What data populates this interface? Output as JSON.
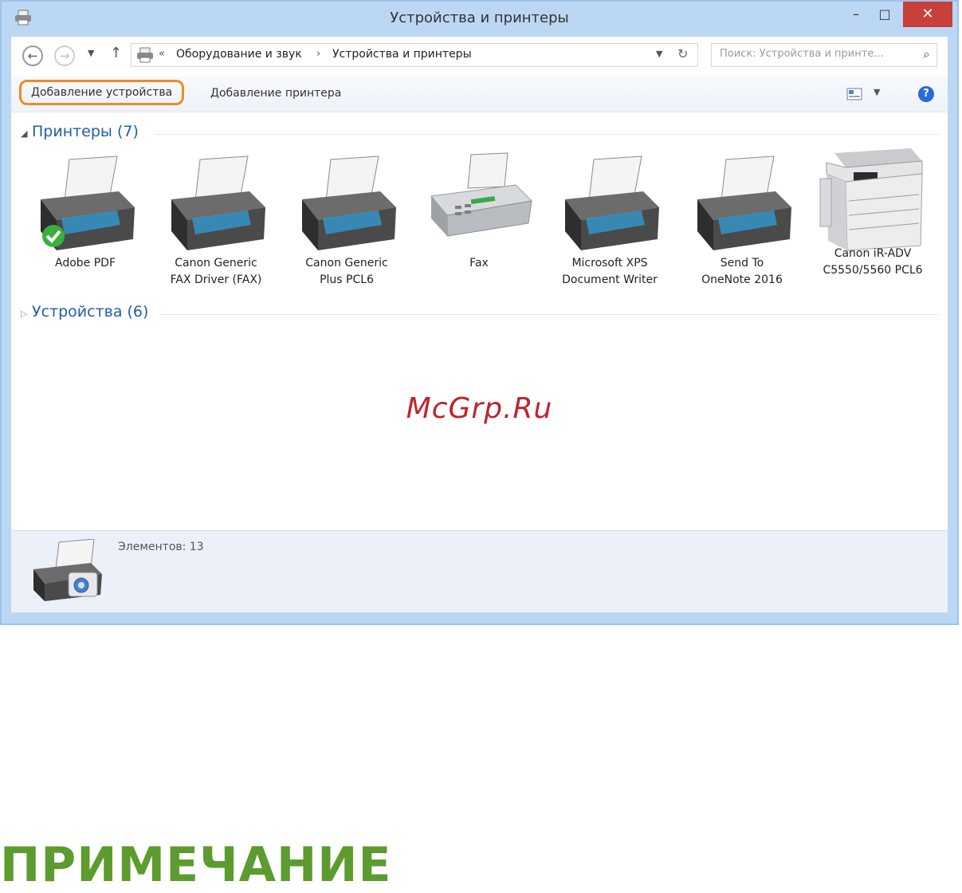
{
  "window": {
    "title": "Устройства и принтеры",
    "buttons": {
      "minimize": "–",
      "maximize": "□",
      "close": "✕"
    }
  },
  "address": {
    "separator": "«",
    "crumbs": [
      "Оборудование и звук",
      "Устройства и принтеры"
    ],
    "crumb_arrow": "›",
    "search_placeholder": "Поиск: Устройства и принте..."
  },
  "toolbar": {
    "add_device_label": "Добавление устройства",
    "add_printer_label": "Добавление принтера"
  },
  "groups": {
    "printers_header": "Принтеры (7)",
    "devices_header": "Устройства (6)"
  },
  "devices": [
    {
      "label": "Adobe PDF",
      "icon": "printer-icon",
      "default": true
    },
    {
      "label": "Canon Generic\nFAX Driver (FAX)",
      "icon": "printer-icon"
    },
    {
      "label": "Canon Generic\nPlus PCL6",
      "icon": "printer-icon"
    },
    {
      "label": "Fax",
      "icon": "fax-icon"
    },
    {
      "label": "Microsoft XPS\nDocument Writer",
      "icon": "printer-icon"
    },
    {
      "label": "Send To\nOneNote 2016",
      "icon": "printer-icon"
    },
    {
      "label": "Canon iR-ADV\nC5550/5560 PCL6",
      "icon": "copier-icon"
    }
  ],
  "watermark": "McGrp.Ru",
  "details": {
    "count_label": "Элементов: 13"
  },
  "page": {
    "note_heading": "ПРИМЕЧАНИЕ"
  },
  "colors": {
    "accent_orange": "#f08a24",
    "group_blue": "#1e5fa8",
    "close_red": "#c7403a",
    "note_green": "#5c9b2e",
    "watermark_red": "#c0232d"
  }
}
